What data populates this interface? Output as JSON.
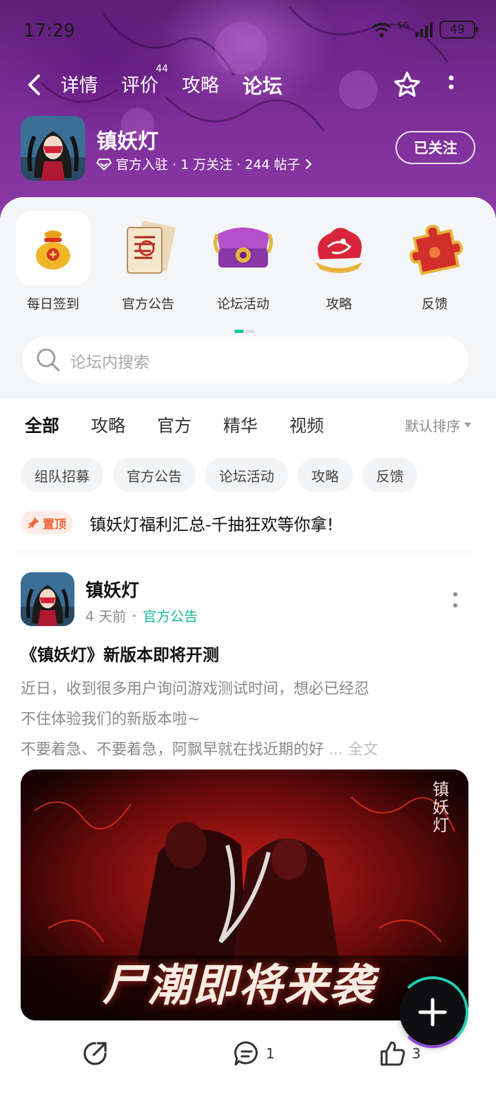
{
  "status_bar": {
    "time": "17:29",
    "network": "5G",
    "battery": "49"
  },
  "nav": {
    "tabs": [
      {
        "label": "详情"
      },
      {
        "label": "评价",
        "badge": "44"
      },
      {
        "label": "攻略"
      },
      {
        "label": "论坛"
      }
    ],
    "active_tab": "论坛"
  },
  "game": {
    "name": "镇妖灯",
    "meta": "官方入驻 · 1 万关注 · 244 帖子",
    "follow_label": "已关注"
  },
  "quick_entries": [
    {
      "label": "每日签到",
      "icon": "lucky-bag-icon"
    },
    {
      "label": "官方公告",
      "icon": "scroll-icon"
    },
    {
      "label": "论坛活动",
      "icon": "treasure-chest-icon"
    },
    {
      "label": "攻略",
      "icon": "dragon-emblem-icon"
    },
    {
      "label": "反馈",
      "icon": "puzzle-piece-icon"
    }
  ],
  "search": {
    "placeholder": "论坛内搜索"
  },
  "filter_tabs": [
    "全部",
    "攻略",
    "官方",
    "精华",
    "视频"
  ],
  "sort_label": "默认排序",
  "chips": [
    "组队招募",
    "官方公告",
    "论坛活动",
    "攻略",
    "反馈"
  ],
  "pinned": {
    "badge": "置顶",
    "title": "镇妖灯福利汇总-千抽狂欢等你拿!"
  },
  "post": {
    "author": "镇妖灯",
    "time": "4 天前",
    "tag": "官方公告",
    "title": "《镇妖灯》新版本即将开测",
    "body_lines": [
      "近日，收到很多用户询问游戏测试时间，想必已经忍",
      "不住体验我们的新版本啦~",
      " 不要着急、不要着急，阿飘早就在找近期的好"
    ],
    "more_label": "... 全文",
    "image_caption": "尸潮即将来袭",
    "image_logo": "镇妖灯",
    "comments": "1",
    "likes": "3"
  },
  "colors": {
    "accent": "#1fd0b2",
    "pin": "#f2673a",
    "banner": "#7b2d96"
  }
}
